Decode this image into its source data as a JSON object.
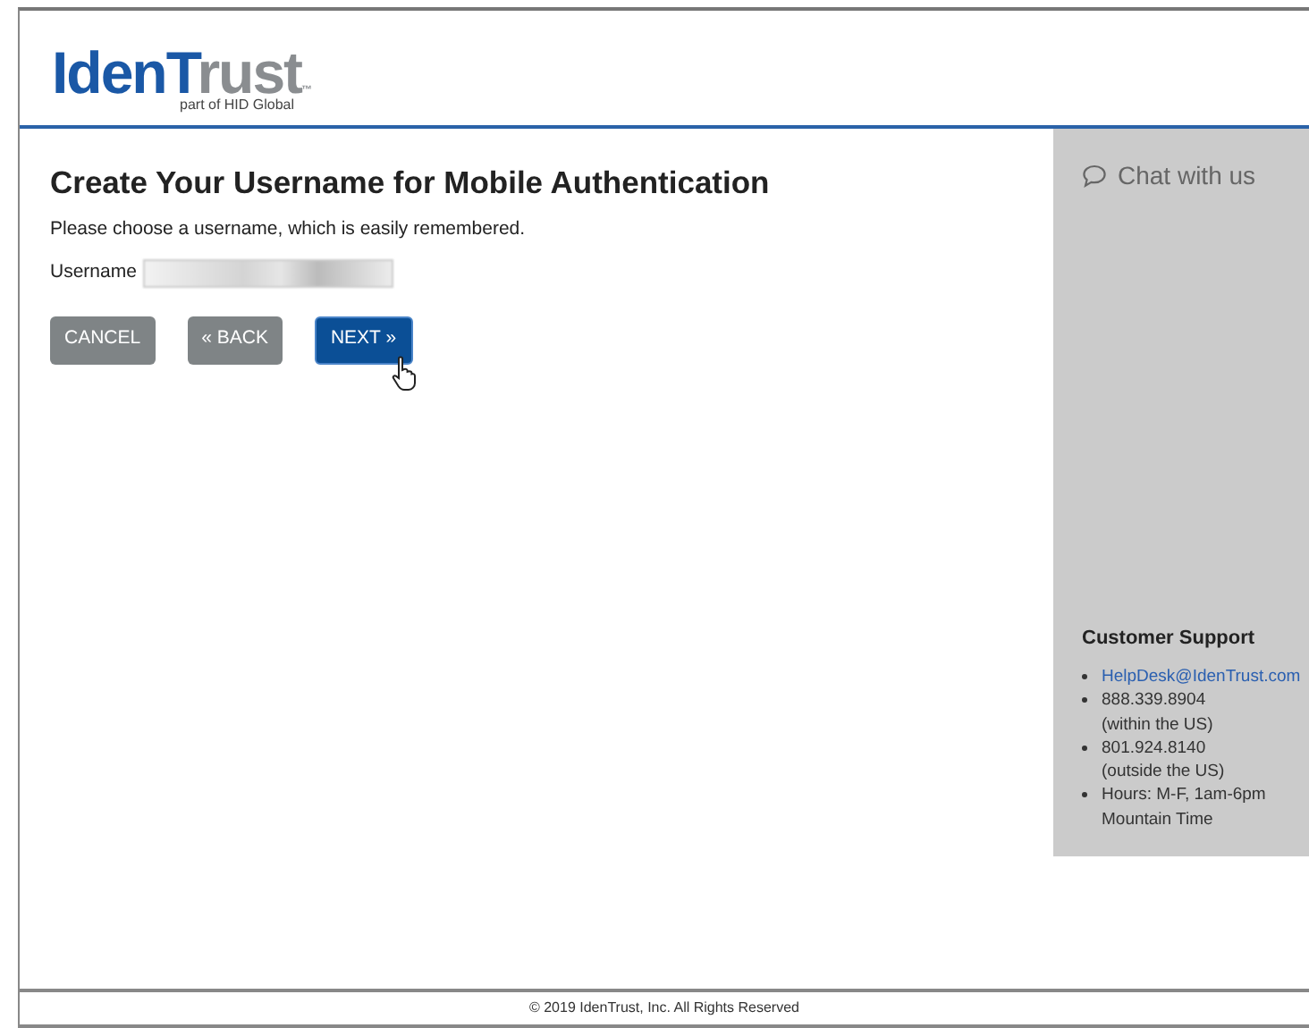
{
  "logo": {
    "primary": "IdenT",
    "secondary": "rust",
    "tm": "™",
    "tagline": "part of HID Global"
  },
  "main": {
    "title": "Create Your Username for Mobile Authentication",
    "instructions": "Please choose a username, which is easily remembered.",
    "field_label": "Username",
    "buttons": [
      {
        "label": "CANCEL",
        "kind": "secondary"
      },
      {
        "label": "« BACK",
        "kind": "secondary"
      },
      {
        "label": "NEXT »",
        "kind": "primary"
      }
    ]
  },
  "sidebar": {
    "chat": "Chat with us",
    "support_title": "Customer Support",
    "items": [
      {
        "kind": "link",
        "lines": [
          "HelpDesk@IdenTrust.com"
        ]
      },
      {
        "kind": "text",
        "lines": [
          "888.339.8904",
          "(within the US)"
        ]
      },
      {
        "kind": "text",
        "lines": [
          "801.924.8140",
          "(outside the US)"
        ]
      },
      {
        "kind": "text",
        "lines": [
          "Hours: M-F, 1am-6pm",
          "Mountain Time"
        ]
      }
    ]
  },
  "footer": "© 2019 IdenTrust, Inc. All Rights Reserved"
}
